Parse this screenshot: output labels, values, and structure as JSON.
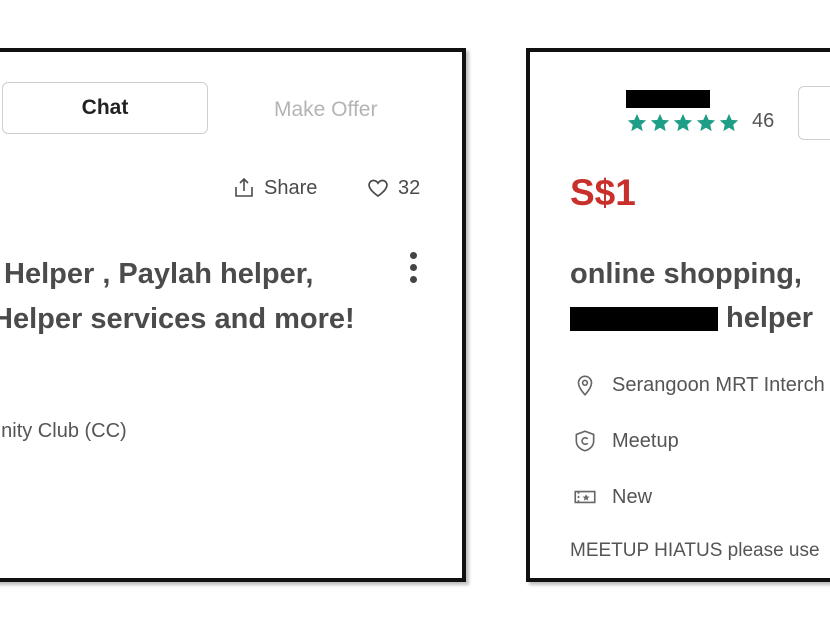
{
  "left": {
    "chat_label": "Chat",
    "make_offer_label": "Make Offer",
    "share_label": "Share",
    "like_count": "32",
    "title_line1": "Helper , Paylah helper,",
    "title_line2": "Helper services and more!",
    "location": "unity Club (CC)"
  },
  "right": {
    "rating_count": "46",
    "price": "S$1",
    "title_line1": "online shopping,",
    "title_line2_suffix": "helper",
    "location": "Serangoon MRT Interch",
    "meetup_label": "Meetup",
    "condition": "New",
    "description": "MEETUP HIATUS please use"
  },
  "colors": {
    "price": "#c9302c",
    "stars": "#1f9e87",
    "make_offer": "#b4b4b4",
    "redaction": "#000000"
  },
  "icons": {
    "share": "share-icon",
    "like": "heart-icon",
    "more": "more-vertical-icon",
    "star": "star-icon",
    "location": "location-pin-icon",
    "meetup": "meetup-shield-icon",
    "condition": "condition-tag-icon"
  }
}
